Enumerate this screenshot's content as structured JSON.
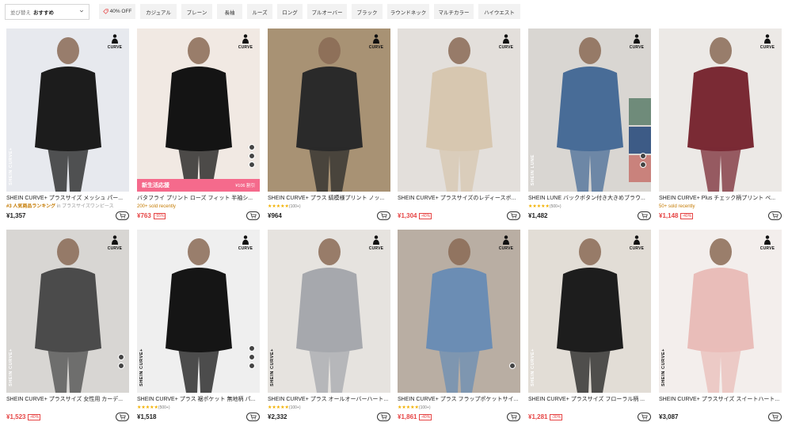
{
  "filter": {
    "sort_label": "並び替え",
    "sort_value": "おすすめ",
    "chips": [
      "40% OFF",
      "カジュアル",
      "プレーン",
      "長袖",
      "ルーズ",
      "ロング",
      "プルオーバー",
      "ブラック",
      "ラウンドネック",
      "マルチカラー",
      "ハイウエスト"
    ]
  },
  "badge_text": "CURVE",
  "products": [
    {
      "title": "SHEIN CURVE+ プラスサイズ メッシュ パー...",
      "price": "¥1,357",
      "rank_label": "#3 人気商品ランキング",
      "rank_sub": "in プラスサイズワンピース",
      "brand_mark": "SHEIN CURVE+",
      "colors": {
        "bg": "#e7e9ee",
        "accent": "#1c1c1c"
      }
    },
    {
      "title": "バタフライ プリント ローズ フィット 半袖シ...",
      "price": "¥763",
      "discount": "-55%",
      "sold": "200+ sold recently",
      "promo_text": "新生活応援",
      "promo_price": "¥106 割引",
      "colors": {
        "bg": "#f1e9e3",
        "accent": "#141414"
      }
    },
    {
      "title": "SHEIN CURVE+ プラス 縞模様プリント ノッ...",
      "price": "¥964",
      "stars": "★★★★★",
      "reviews": "(100+)",
      "colors": {
        "bg": "#a89274",
        "accent": "#2a2a2a"
      }
    },
    {
      "title": "SHEIN CURVE+ プラスサイズのレディースボ...",
      "price": "¥1,304",
      "discount": "-40%",
      "colors": {
        "bg": "#e3dfdb",
        "accent": "#d7c7b0"
      }
    },
    {
      "title": "SHEIN LUNE バックボタン付き大きめブラウ...",
      "price": "¥1,482",
      "stars": "★★★★★",
      "reviews": "(500+)",
      "brand_mark": "SHEIN LUNE",
      "colors": {
        "bg": "#d9d6d2",
        "accent": "#486c97"
      }
    },
    {
      "title": "SHEIN CURVE+ Plus チェック柄プリント ベ...",
      "price": "¥1,148",
      "discount": "-40%",
      "sold": "50+ sold recently",
      "colors": {
        "bg": "#ece9e6",
        "accent": "#7a2a34"
      }
    },
    {
      "title": "SHEIN CURVE+ プラスサイズ 女性用 カーデ...",
      "price": "¥1,523",
      "discount": "-40%",
      "brand_mark": "SHEIN CURVE+",
      "colors": {
        "bg": "#d8d6d3",
        "accent": "#4b4b4b"
      }
    },
    {
      "title": "SHEIN CURVE+ プラス 裾ポケット 無地柄 パ...",
      "price": "¥1,518",
      "stars": "★★★★★",
      "reviews": "(500+)",
      "brand_mark": "SHEIN CURVE+",
      "colors": {
        "bg": "#efefef",
        "accent": "#151515"
      }
    },
    {
      "title": "SHEIN CURVE+ プラス オールオーバーハート...",
      "price": "¥2,332",
      "stars": "★★★★★",
      "reviews": "(100+)",
      "brand_mark": "SHEIN CURVE+",
      "colors": {
        "bg": "#e6e3df",
        "accent": "#a6a8ad"
      }
    },
    {
      "title": "SHEIN CURVE+ プラス フラップポケットサイ...",
      "price": "¥1,861",
      "discount": "-40%",
      "stars": "★★★★★",
      "reviews": "(100+)",
      "colors": {
        "bg": "#b9aea3",
        "accent": "#6b8db4"
      }
    },
    {
      "title": "SHEIN CURVE+ プラスサイズ フローラル柄 ...",
      "price": "¥1,281",
      "discount": "-30%",
      "brand_mark": "SHEIN CURVE+",
      "colors": {
        "bg": "#e2ddd6",
        "accent": "#1d1d1d"
      }
    },
    {
      "title": "SHEIN CURVE+ プラスサイズ スイートハート...",
      "price": "¥3,087",
      "brand_mark": "SHEIN CURVE+",
      "colors": {
        "bg": "#f3eeec",
        "accent": "#e9bdb9"
      }
    }
  ]
}
